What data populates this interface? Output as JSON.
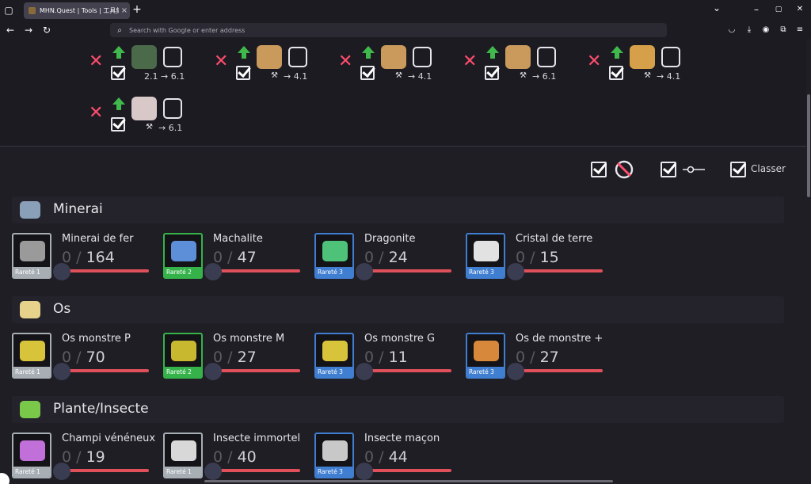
{
  "browser": {
    "tab_title": "MHN.Quest | Tools | 工具集",
    "tab_close": "×",
    "new_tab": "+",
    "url_placeholder": "Search with Google or enter address",
    "window_min": "–",
    "window_max": "▢",
    "window_close": "✕",
    "tab_list_chevron": "⌄"
  },
  "requirements": [
    {
      "level_text": "2.1 → 6.1",
      "monster_color": "#4a6a4a",
      "weapon": "sword"
    },
    {
      "level_text": "→ 4.1",
      "monster_color": "#c99a5c",
      "weapon": "helm"
    },
    {
      "level_text": "→ 4.1",
      "monster_color": "#c99a5c",
      "weapon": "gauntlet"
    },
    {
      "level_text": "→ 6.1",
      "monster_color": "#c99a5c",
      "weapon": "greaves"
    },
    {
      "level_text": "→ 4.1",
      "monster_color": "#d6a04a",
      "weapon": "armor"
    },
    {
      "level_text": "→ 6.1",
      "monster_color": "#d8c8c8",
      "weapon": "waist"
    }
  ],
  "options": {
    "classer_label": "Classer"
  },
  "sections": [
    {
      "title": "Minerai",
      "icon_color": "#8aa0b8",
      "items": [
        {
          "name": "Minerai de fer",
          "current": "0",
          "total": "164",
          "rarity": "Rareté 1",
          "rarity_color": "#a7aeb4",
          "art_color": "#9a9a9a"
        },
        {
          "name": "Machalite",
          "current": "0",
          "total": "47",
          "rarity": "Rareté 2",
          "rarity_color": "#35b34a",
          "art_color": "#5d8ed8"
        },
        {
          "name": "Dragonite",
          "current": "0",
          "total": "24",
          "rarity": "Rareté 3",
          "rarity_color": "#3f7ed0",
          "art_color": "#4fc27a"
        },
        {
          "name": "Cristal de terre",
          "current": "0",
          "total": "15",
          "rarity": "Rareté 3",
          "rarity_color": "#3f7ed0",
          "art_color": "#e2e2e2"
        }
      ]
    },
    {
      "title": "Os",
      "icon_color": "#e6d28a",
      "items": [
        {
          "name": "Os monstre P",
          "current": "0",
          "total": "70",
          "rarity": "Rareté 1",
          "rarity_color": "#a7aeb4",
          "art_color": "#d8c43a"
        },
        {
          "name": "Os monstre M",
          "current": "0",
          "total": "27",
          "rarity": "Rareté 2",
          "rarity_color": "#35b34a",
          "art_color": "#c8b830"
        },
        {
          "name": "Os monstre G",
          "current": "0",
          "total": "11",
          "rarity": "Rareté 3",
          "rarity_color": "#3f7ed0",
          "art_color": "#d8c43a"
        },
        {
          "name": "Os de monstre +",
          "current": "0",
          "total": "27",
          "rarity": "Rareté 3",
          "rarity_color": "#3f7ed0",
          "art_color": "#d8883a"
        }
      ]
    },
    {
      "title": "Plante/Insecte",
      "icon_color": "#7ac84a",
      "items": [
        {
          "name": "Champi vénéneux",
          "current": "0",
          "total": "19",
          "rarity": "Rareté 1",
          "rarity_color": "#a7aeb4",
          "art_color": "#c070d8"
        },
        {
          "name": "Insecte immortel",
          "current": "0",
          "total": "40",
          "rarity": "Rareté 1",
          "rarity_color": "#a7aeb4",
          "art_color": "#d8d8d8"
        },
        {
          "name": "Insecte maçon",
          "current": "0",
          "total": "44",
          "rarity": "Rareté 3",
          "rarity_color": "#3f7ed0",
          "art_color": "#c8c8c8"
        }
      ]
    }
  ]
}
